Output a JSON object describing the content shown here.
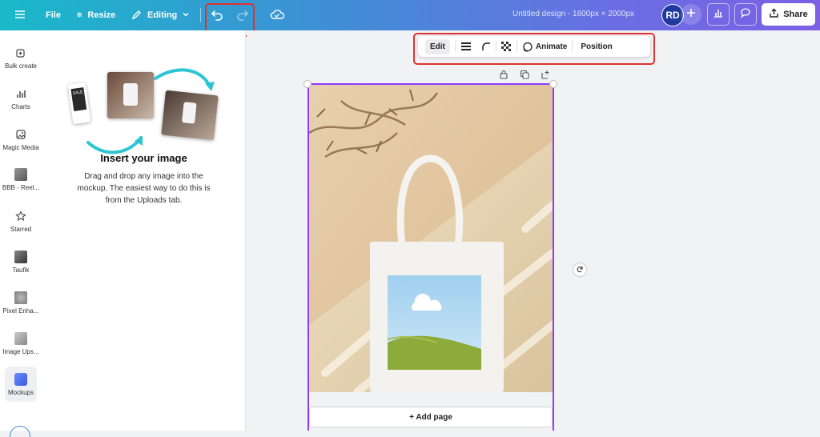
{
  "topbar": {
    "file_label": "File",
    "resize_label": "Resize",
    "editing_label": "Editing",
    "doc_title": "Untitled design - 1600px × 2000px",
    "avatar_initials": "RD",
    "share_label": "Share"
  },
  "sidebar": {
    "items": [
      {
        "label": "Bulk create"
      },
      {
        "label": "Charts"
      },
      {
        "label": "Magic Media"
      },
      {
        "label": "BBB - Reel..."
      },
      {
        "label": "Starred"
      },
      {
        "label": "Taufik"
      },
      {
        "label": "Pixel Enha..."
      },
      {
        "label": "Image Ups..."
      },
      {
        "label": "Mockups"
      }
    ]
  },
  "panel": {
    "heading": "Insert your image",
    "description": "Drag and drop any image into the mockup. The easiest way to do this is from the Uploads tab.",
    "mini_card_text": "SALE"
  },
  "context_toolbar": {
    "edit_label": "Edit",
    "animate_label": "Animate",
    "position_label": "Position"
  },
  "canvas": {
    "add_page_label": "+ Add page"
  },
  "colors": {
    "highlight": "#e0322f",
    "selection": "#8b3dff",
    "topbar_start": "#19b9c9",
    "topbar_end": "#7c60e6"
  }
}
